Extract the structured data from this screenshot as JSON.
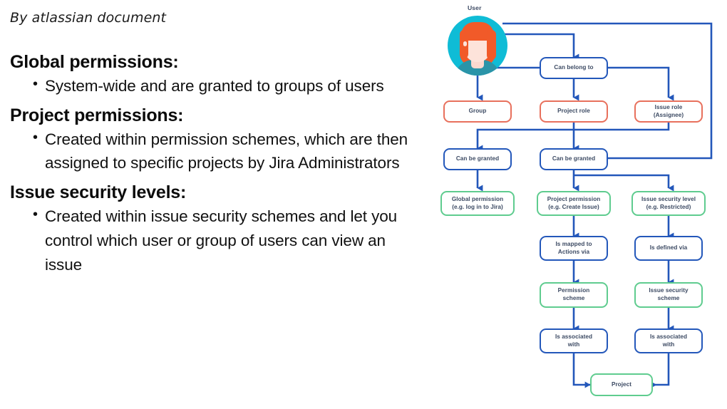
{
  "byline": "By atlassian document",
  "sections": [
    {
      "heading": "Global permissions:",
      "bullets": [
        "System-wide and are granted to groups of users"
      ]
    },
    {
      "heading": "Project permissions:",
      "bullets": [
        "Created within permission schemes, which are then assigned to specific projects by Jira Administrators"
      ]
    },
    {
      "heading": "Issue security levels:",
      "bullets": [
        "Created within issue security schemes and let you control which user or group of users can view an issue"
      ]
    }
  ],
  "diagram": {
    "user_caption": "User",
    "nodes": {
      "can_belong_to": "Can belong to",
      "group": "Group",
      "project_role": "Project role",
      "issue_role_line1": "Issue role",
      "issue_role_line2": "(Assignee)",
      "can_be_granted_left": "Can be granted",
      "can_be_granted_mid": "Can be granted",
      "global_permission_line1": "Global permission",
      "global_permission_line2": "(e.g. log in to Jira)",
      "project_permission_line1": "Project permission",
      "project_permission_line2": "(e.g. Create Issue)",
      "issue_security_level_line1": "Issue security level",
      "issue_security_level_line2": "(e.g. Restricted)",
      "is_mapped_to_line1": "Is mapped to",
      "is_mapped_to_line2": "Actions via",
      "is_defined_via": "Is defined via",
      "permission_scheme_line1": "Permission",
      "permission_scheme_line2": "scheme",
      "issue_security_scheme_line1": "Issue security",
      "issue_security_scheme_line2": "scheme",
      "is_associated_with_left_line1": "Is associated",
      "is_associated_with_left_line2": "with",
      "is_associated_with_right_line1": "Is associated",
      "is_associated_with_right_line2": "with",
      "project": "Project"
    },
    "colors": {
      "connector_blue": "#2357ba",
      "node_blue": "#2357ba",
      "node_orange": "#e8705c",
      "node_green": "#5fcc8f",
      "avatar_bg": "#0fbcd6",
      "avatar_hair": "#f15a29",
      "avatar_skin": "#fde3da",
      "avatar_shirt": "#2a94a8",
      "text": "#3c4a63"
    }
  }
}
